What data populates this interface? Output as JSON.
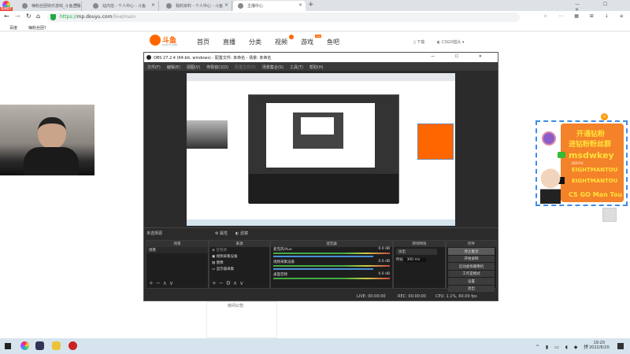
{
  "browser": {
    "badge": "极速模式",
    "tabs": [
      {
        "label": "嗨粉丝团快乐游戏_斗鱼直播"
      },
      {
        "label": "站内信 - 个人中心 - 斗鱼"
      },
      {
        "label": "我的资料 - 个人中心 - 斗鱼"
      },
      {
        "label": "主播中心"
      }
    ],
    "new_tab": "+",
    "url_scheme": "https://",
    "url_host": "mp.douyu.com",
    "url_path": "/live/main",
    "bookmarks": [
      "百度",
      "嗨粉丝团?"
    ]
  },
  "site": {
    "logo": "斗鱼",
    "logo_sub": "DOUYU.COM",
    "nav": [
      "首页",
      "直播",
      "分类",
      "视频",
      "游戏",
      "鱼吧"
    ],
    "game_badge": "new",
    "download": "下载",
    "user": "CSGO猎头"
  },
  "obs": {
    "title": "OBS 27.2.4 (64-bit, windows) - 配置文件: 未命名 - 场景: 未命名",
    "menu": [
      "文件(F)",
      "编辑(E)",
      "视图(V)",
      "停靠窗口(D)",
      "配置文件(P)",
      "场景集合(S)",
      "工具(T)",
      "帮助(H)"
    ],
    "no_source": "未选择源",
    "props_btn": "属性",
    "filters_btn": "滤镜",
    "panels": {
      "scenes": "场景",
      "sources": "来源",
      "mixer": "混音器",
      "transitions": "转场特效",
      "controls": "控件"
    },
    "scene_items": [
      "场景"
    ],
    "sources": [
      "音频源",
      "视频采集设备",
      "图像",
      "显示器采集"
    ],
    "mixer": [
      {
        "name": "麦克风/Aux",
        "db": "0.0 dB"
      },
      {
        "name": "视频采集设备",
        "db": "0.0 dB"
      },
      {
        "name": "桌面音频",
        "db": "0.0 dB"
      }
    ],
    "transition": "淡出",
    "duration_label": "时长",
    "duration": "300 ms",
    "controls": [
      "停止推流",
      "开始录制",
      "启动虚拟摄像机",
      "工作室模式",
      "设置",
      "退出"
    ],
    "status": {
      "live": "LIVE: 00:00:00",
      "rec": "REC: 00:00:00",
      "cpu": "CPU: 1.1%, 60.00 fps"
    }
  },
  "room_notice": "房间公告:",
  "overlay": {
    "line1": "开通钻粉",
    "line2": "进钻粉粉丝群",
    "handle": "msdwkey",
    "id1": "EIGHTMANTOU",
    "id2": "EIGHTMANTOU",
    "footer": "CS GO Man Tou",
    "douyu": "DOUYU"
  },
  "taskbar": {
    "time": "19:20",
    "date": "2022/6/20"
  }
}
